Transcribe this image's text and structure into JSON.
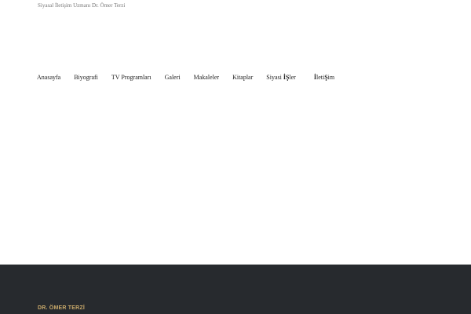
{
  "header": {
    "tagline": "Siyasal İletişim Uzmanı Dr. Ömer Terzi"
  },
  "nav": {
    "items": [
      {
        "label": "Anasayfa"
      },
      {
        "label": "Biyografi"
      },
      {
        "label": "TV Programları"
      },
      {
        "label": "Galeri"
      },
      {
        "label": "Makaleler"
      },
      {
        "label": "Kitaplar"
      },
      {
        "label_parts": [
          "Siyasi ",
          "İŞ",
          "ler"
        ]
      },
      {
        "label_parts": [
          "İ",
          "leti",
          "Ş",
          "im"
        ]
      }
    ]
  },
  "footer": {
    "title": "DR. ÖMER TERZİ",
    "background_color": "#272a2e",
    "title_color": "#c9a96a"
  }
}
